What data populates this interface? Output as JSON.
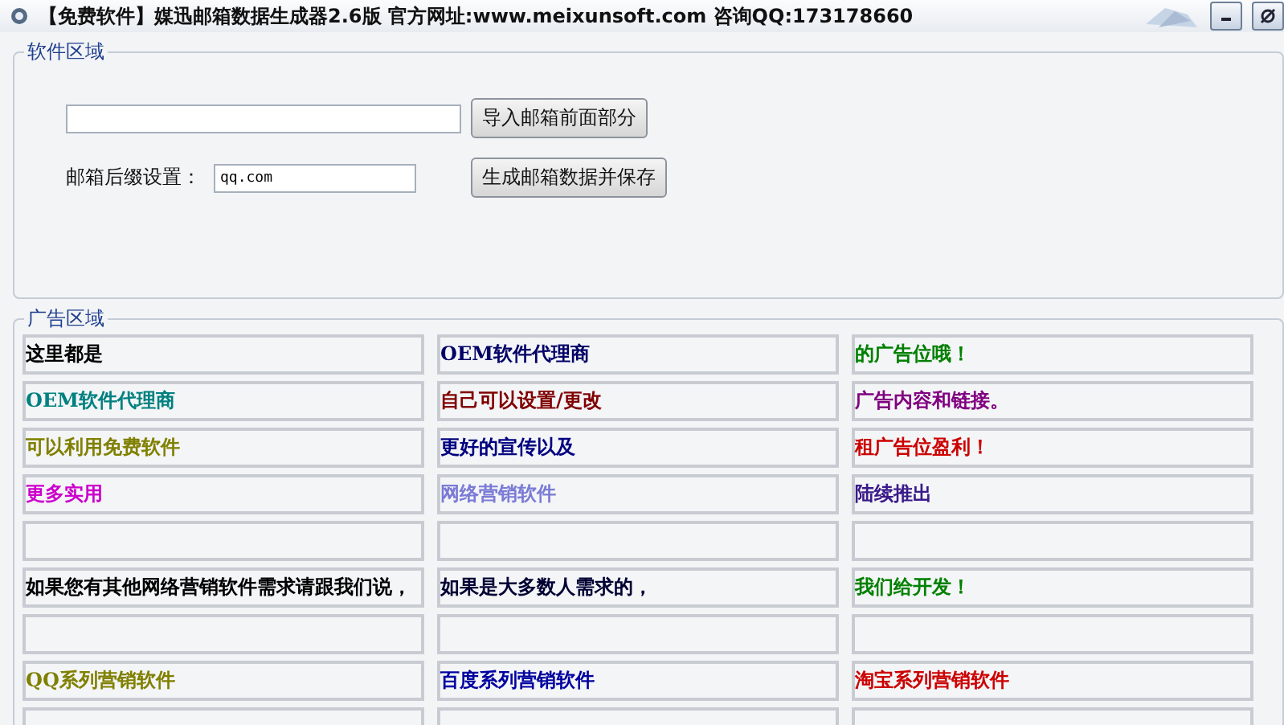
{
  "window": {
    "title": "【免费软件】媒迅邮箱数据生成器2.6版  官方网址:www.meixunsoft.com 咨询QQ:173178660"
  },
  "software_area": {
    "legend": "软件区域",
    "import_button": "导入邮箱前面部分",
    "suffix_label": "邮箱后缀设置：",
    "suffix_field": {
      "value": "qq.com"
    },
    "generate_button": "生成邮箱数据并保存"
  },
  "ad_area": {
    "legend": "广告区域",
    "rows": [
      [
        {
          "text": "这里都是",
          "color": "#000000"
        },
        {
          "text": "OEM软件代理商",
          "color": "#000066"
        },
        {
          "text": "的广告位哦！",
          "color": "#008000"
        }
      ],
      [
        {
          "text": "OEM软件代理商",
          "color": "#008080"
        },
        {
          "text": "自己可以设置/更改",
          "color": "#800000"
        },
        {
          "text": "广告内容和链接。",
          "color": "#800080"
        }
      ],
      [
        {
          "text": "可以利用免费软件",
          "color": "#808000"
        },
        {
          "text": "更好的宣传以及",
          "color": "#000080"
        },
        {
          "text": "租广告位盈利！",
          "color": "#cc0000"
        }
      ],
      [
        {
          "text": "更多实用",
          "color": "#cc00cc"
        },
        {
          "text": "网络营销软件",
          "color": "#7b7bd6"
        },
        {
          "text": "陆续推出",
          "color": "#3a1a8a"
        }
      ],
      [
        {},
        {},
        {}
      ],
      [
        {
          "text": "如果您有其他网络营销软件需求请跟我们说，",
          "color": "#000000"
        },
        {
          "text": "如果是大多数人需求的，",
          "color": "#000033"
        },
        {
          "text": "我们给开发！",
          "color": "#008000"
        }
      ],
      [
        {},
        {},
        {}
      ],
      [
        {
          "text": "QQ系列营销软件",
          "color": "#808000"
        },
        {
          "text": "百度系列营销软件",
          "color": "#0000a0"
        },
        {
          "text": "淘宝系列营销软件",
          "color": "#cc0000"
        }
      ],
      [
        {},
        {},
        {}
      ]
    ]
  }
}
